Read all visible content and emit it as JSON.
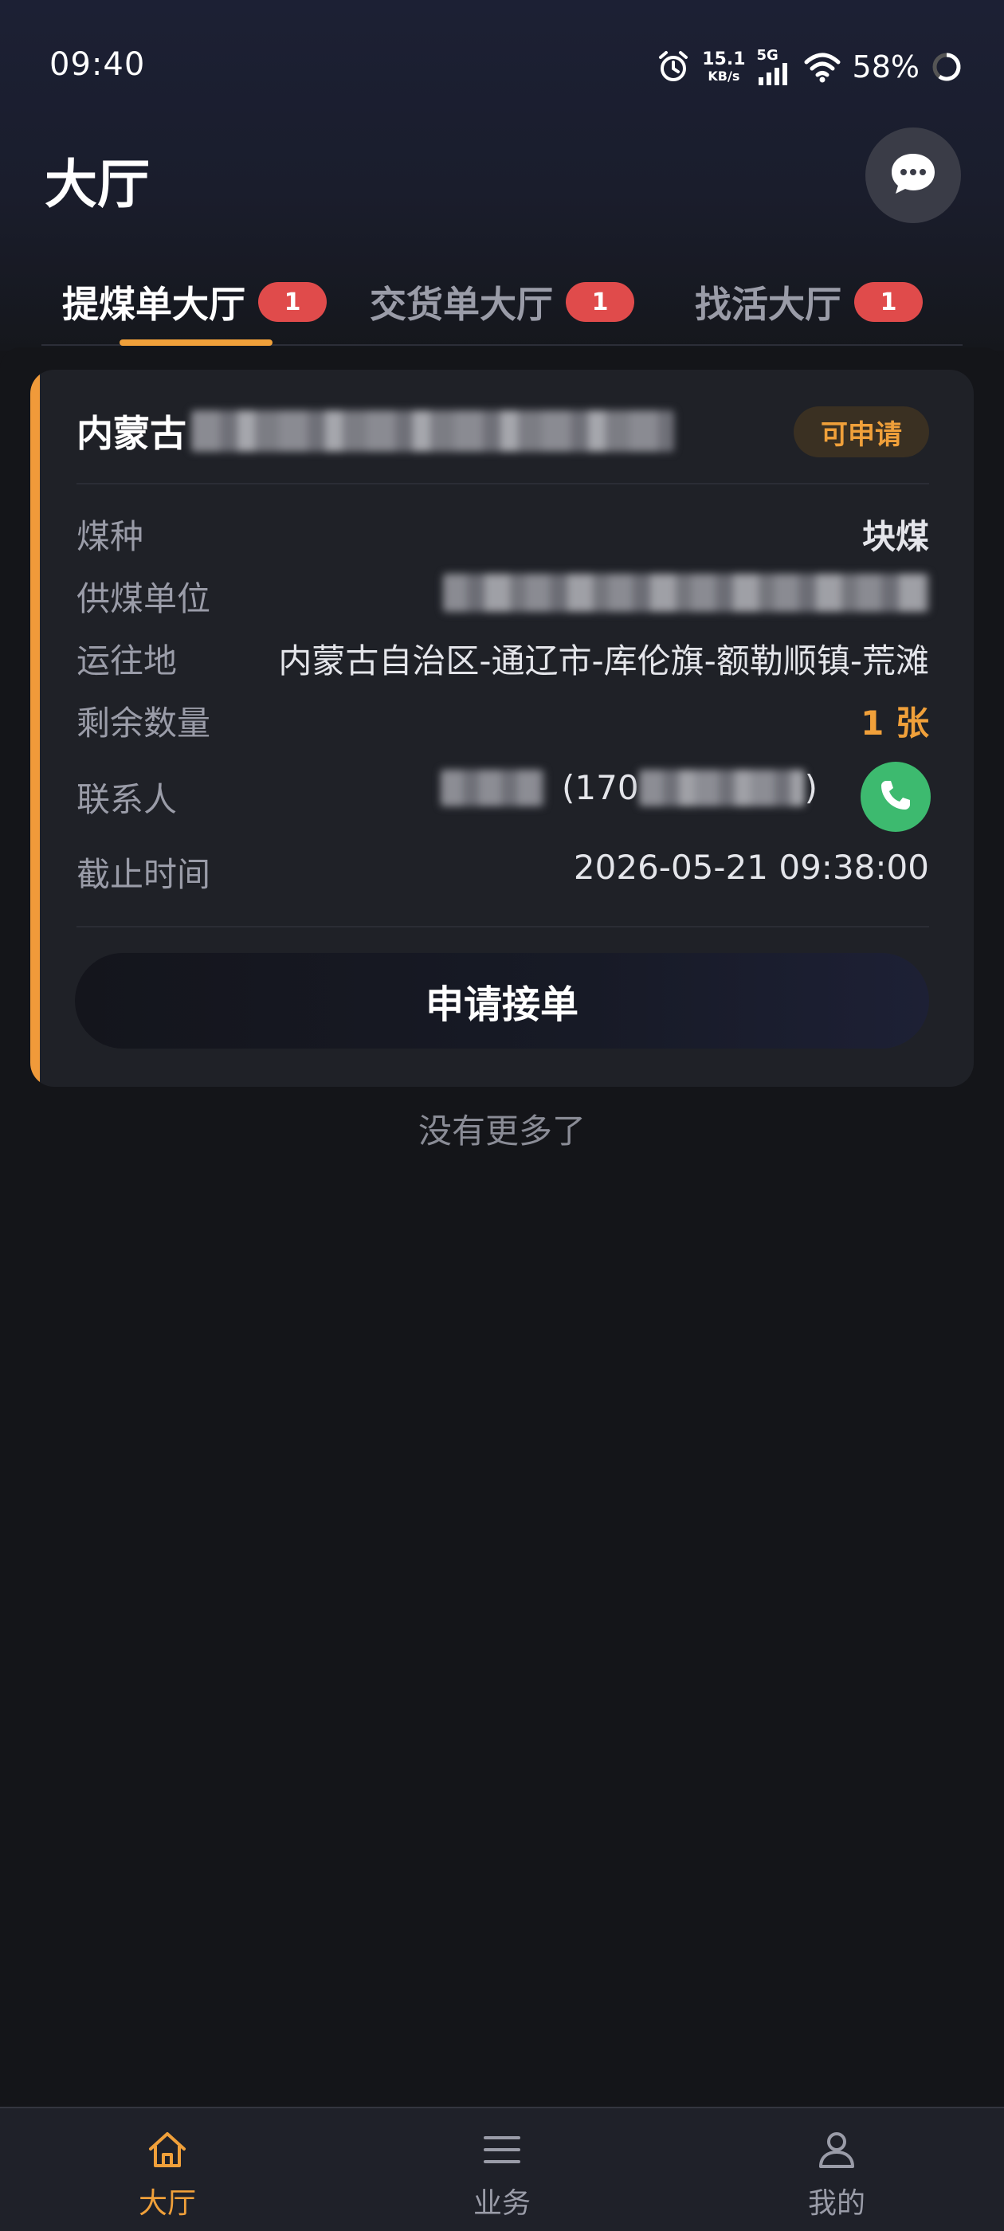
{
  "status_bar": {
    "time": "09:40",
    "net_speed_value": "15.1",
    "net_speed_unit": "KB/s",
    "network": "5G",
    "battery": "58%",
    "icons": [
      "alarm-icon",
      "signal-icon",
      "wifi-icon",
      "battery-ring-icon"
    ]
  },
  "header": {
    "title": "大厅",
    "message_icon": "chat-bubble-icon"
  },
  "tabs": [
    {
      "label": "提煤单大厅",
      "badge": "1",
      "active": true
    },
    {
      "label": "交货单大厅",
      "badge": "1",
      "active": false
    },
    {
      "label": "找活大厅",
      "badge": "1",
      "active": false
    }
  ],
  "card": {
    "title_prefix": "内蒙古",
    "status": "可申请",
    "rows": {
      "coal_type": {
        "label": "煤种",
        "value": "块煤"
      },
      "supplier": {
        "label": "供煤单位"
      },
      "destination": {
        "label": "运往地",
        "value": "内蒙古自治区-通辽市-库伦旗-额勒顺镇-荒滩"
      },
      "remaining": {
        "label": "剩余数量",
        "value": "1 张"
      },
      "contact": {
        "label": "联系人",
        "phone_open": "(170",
        "phone_close": ")"
      },
      "deadline": {
        "label": "截止时间",
        "value": "2026-05-21 09:38:00"
      }
    },
    "apply_button": "申请接单"
  },
  "footer_text": "没有更多了",
  "bottom_nav": [
    {
      "label": "大厅",
      "icon": "home-icon",
      "active": true
    },
    {
      "label": "业务",
      "icon": "list-icon",
      "active": false
    },
    {
      "label": "我的",
      "icon": "user-icon",
      "active": false
    }
  ],
  "colors": {
    "accent": "#f0a03a",
    "badge": "#e04b4b",
    "call": "#3dba6f",
    "background": "#141519",
    "card": "#1f2127"
  }
}
